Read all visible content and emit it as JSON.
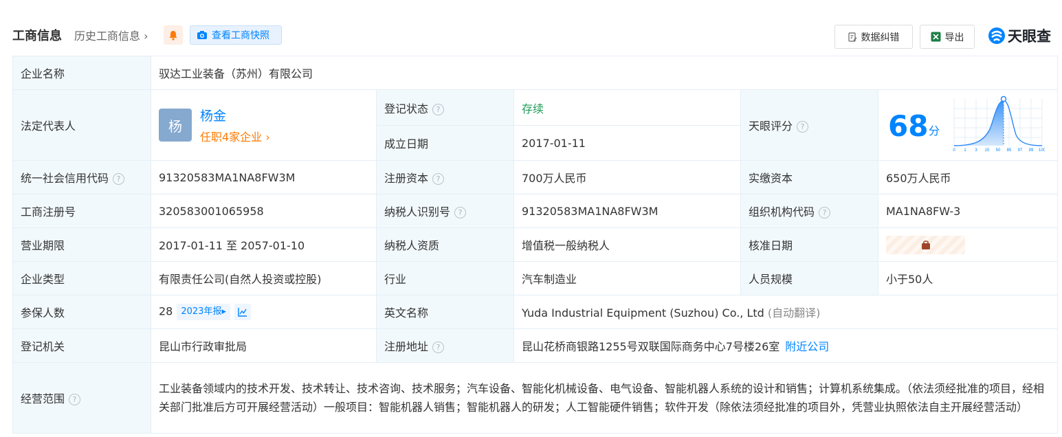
{
  "header": {
    "title": "工商信息",
    "history": "历史工商信息",
    "snapshot": "查看工商快照",
    "correct": "数据纠错",
    "export": "导出",
    "logo": "天眼查"
  },
  "rows": {
    "company_name": {
      "label": "企业名称",
      "value": "驭达工业装备（苏州）有限公司"
    },
    "legal_rep": {
      "label": "法定代表人",
      "avatar": "杨",
      "name": "杨金",
      "sub": "任职4家企业"
    },
    "reg_status": {
      "label": "登记状态",
      "value": "存续"
    },
    "found_date": {
      "label": "成立日期",
      "value": "2017-01-11"
    },
    "score": {
      "label": "天眼评分",
      "value": "68",
      "unit": "分",
      "ticks": [
        "0",
        "1",
        "3",
        "15",
        "50",
        "85",
        "97",
        "99",
        "100"
      ]
    },
    "credit_code": {
      "label": "统一社会信用代码",
      "value": "91320583MA1NA8FW3M"
    },
    "reg_capital": {
      "label": "注册资本",
      "value": "700万人民币"
    },
    "paid_capital": {
      "label": "实缴资本",
      "value": "650万人民币"
    },
    "biz_reg_no": {
      "label": "工商注册号",
      "value": "320583001065958"
    },
    "taxpayer_id": {
      "label": "纳税人识别号",
      "value": "91320583MA1NA8FW3M"
    },
    "org_code": {
      "label": "组织机构代码",
      "value": "MA1NA8FW-3"
    },
    "term": {
      "label": "营业期限",
      "value": "2017-01-11 至 2057-01-10"
    },
    "taxpayer_qual": {
      "label": "纳税人资质",
      "value": "增值税一般纳税人"
    },
    "approve_date": {
      "label": "核准日期"
    },
    "company_type": {
      "label": "企业类型",
      "value": "有限责任公司(自然人投资或控股)"
    },
    "industry": {
      "label": "行业",
      "value": "汽车制造业"
    },
    "staff_size": {
      "label": "人员规模",
      "value": "小于50人"
    },
    "insured": {
      "label": "参保人数",
      "value": "28",
      "report": "2023年报"
    },
    "english_name": {
      "label": "英文名称",
      "value": "Yuda Industrial Equipment (Suzhou) Co., Ltd",
      "note": "(自动翻译)"
    },
    "authority": {
      "label": "登记机关",
      "value": "昆山市行政审批局"
    },
    "address": {
      "label": "注册地址",
      "value": "昆山花桥商银路1255号双联国际商务中心7号楼26室",
      "link": "附近公司"
    },
    "scope": {
      "label": "经营范围",
      "value": "工业装备领域内的技术开发、技术转让、技术咨询、技术服务；汽车设备、智能化机械设备、电气设备、智能机器人系统的设计和销售；计算机系统集成。（依法须经批准的项目，经相关部门批准后方可开展经营活动）一般项目：智能机器人销售；智能机器人的研发；人工智能硬件销售；软件开发（除依法须经批准的项目外，凭营业执照依法自主开展经营活动）"
    }
  },
  "colors": {
    "accent": "#0084ff",
    "label_bg": "#f2f9fc",
    "status_green": "#1d9b55",
    "orange": "#ff7a00"
  }
}
